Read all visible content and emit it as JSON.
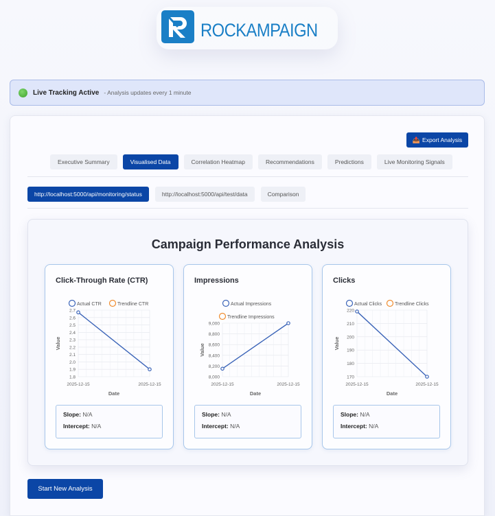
{
  "brand": {
    "name": "ROCKAMPAIGN",
    "primary_color": "#0b46a6",
    "logo_color": "#1a7fc6",
    "logo_icon": "rockampaign-r-logo"
  },
  "live": {
    "title": "Live Tracking Active",
    "subtitle": "- Analysis updates every 1 minute",
    "status_color": "#3fa22e",
    "icon": "green-status-dot-icon"
  },
  "toolbar": {
    "export_label": "Export Analysis",
    "export_icon": "📤"
  },
  "tabs": [
    {
      "label": "Executive Summary",
      "active": false
    },
    {
      "label": "Visualised Data",
      "active": true
    },
    {
      "label": "Correlation Heatmap",
      "active": false
    },
    {
      "label": "Recommendations",
      "active": false
    },
    {
      "label": "Predictions",
      "active": false
    },
    {
      "label": "Live Monitoring Signals",
      "active": false
    }
  ],
  "subtabs": [
    {
      "label": "http://localhost:5000/api/monitoring/status",
      "active": true
    },
    {
      "label": "http://localhost:5000/api/test/data",
      "active": false
    },
    {
      "label": "Comparison",
      "active": false
    }
  ],
  "analysis": {
    "title": "Campaign Performance Analysis"
  },
  "stats_labels": {
    "slope": "Slope:",
    "intercept": "Intercept:"
  },
  "charts": [
    {
      "title": "Click-Through Rate (CTR)",
      "slope": "N/A",
      "intercept": "N/A"
    },
    {
      "title": "Impressions",
      "slope": "N/A",
      "intercept": "N/A"
    },
    {
      "title": "Clicks",
      "slope": "N/A",
      "intercept": "N/A"
    }
  ],
  "chart_data": [
    {
      "type": "line",
      "x": [
        "2025-12-15",
        "2025-12-15"
      ],
      "series": [
        {
          "name": "Actual CTR",
          "values": [
            2.67,
            1.9
          ],
          "color": "#3b64b8"
        },
        {
          "name": "Trendline CTR",
          "values": [],
          "color": "#f08c2e"
        }
      ],
      "xlabel": "Date",
      "ylabel": "Value",
      "ylim": [
        1.8,
        2.7
      ],
      "yticks": [
        "1.8",
        "1.9",
        "2.0",
        "2.1",
        "2.2",
        "2.3",
        "2.4",
        "2.5",
        "2.6",
        "2.7"
      ],
      "grid": true,
      "legend": "top"
    },
    {
      "type": "line",
      "x": [
        "2025-12-15",
        "2025-12-15"
      ],
      "series": [
        {
          "name": "Actual Impressions",
          "values": [
            8150,
            9000
          ],
          "color": "#3b64b8"
        },
        {
          "name": "Trendline Impressions",
          "values": [],
          "color": "#f08c2e"
        }
      ],
      "xlabel": "Date",
      "ylabel": "Value",
      "ylim": [
        8000,
        9000
      ],
      "yticks": [
        "8,000",
        "8,200",
        "8,400",
        "8,600",
        "8,800",
        "9,000"
      ],
      "grid": true,
      "legend": "top"
    },
    {
      "type": "line",
      "x": [
        "2025-12-15",
        "2025-12-15"
      ],
      "series": [
        {
          "name": "Actual Clicks",
          "values": [
            219,
            170
          ],
          "color": "#3b64b8"
        },
        {
          "name": "Trendline Clicks",
          "values": [],
          "color": "#f08c2e"
        }
      ],
      "xlabel": "Date",
      "ylabel": "Value",
      "ylim": [
        170,
        220
      ],
      "yticks": [
        "170",
        "180",
        "190",
        "200",
        "210",
        "220"
      ],
      "grid": true,
      "legend": "top"
    }
  ],
  "actions": {
    "start_new": "Start New Analysis"
  }
}
